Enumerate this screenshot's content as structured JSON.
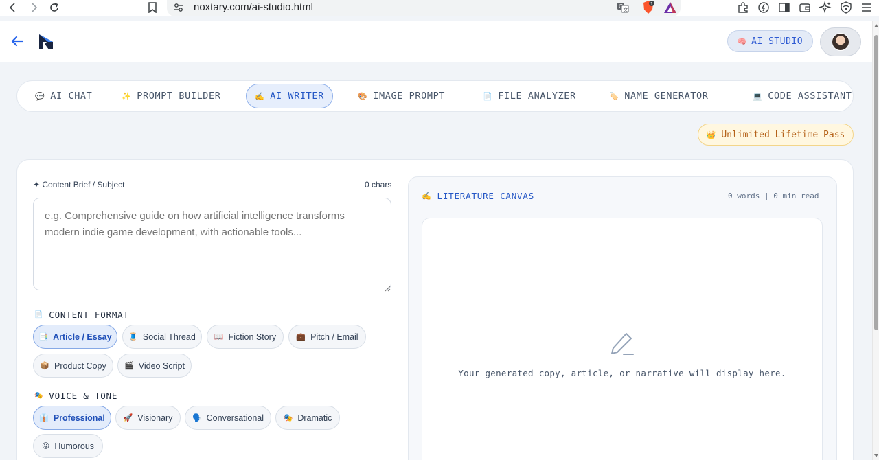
{
  "browser": {
    "url": "noxtary.com/ai-studio.html",
    "extension_badge": "1"
  },
  "header": {
    "studio_label": "AI STUDIO",
    "studio_icon": "🧠"
  },
  "tabs": [
    {
      "icon": "💬",
      "label": "AI CHAT"
    },
    {
      "icon": "✨",
      "label": "PROMPT BUILDER"
    },
    {
      "icon": "✍️",
      "label": "AI WRITER"
    },
    {
      "icon": "🎨",
      "label": "IMAGE PROMPT"
    },
    {
      "icon": "📄",
      "label": "FILE ANALYZER"
    },
    {
      "icon": "🏷️",
      "label": "NAME GENERATOR"
    },
    {
      "icon": "💻",
      "label": "CODE ASSISTANT"
    }
  ],
  "pass": {
    "icon": "👑",
    "label": "Unlimited Lifetime Pass"
  },
  "brief": {
    "label": "✦ Content Brief / Subject",
    "char_count": "0 chars",
    "placeholder": "e.g. Comprehensive guide on how artificial intelligence transforms modern indie game development, with actionable tools..."
  },
  "content_format": {
    "icon": "📄",
    "title": "CONTENT FORMAT",
    "options": [
      {
        "icon": "📑",
        "label": "Article / Essay"
      },
      {
        "icon": "🧵",
        "label": "Social Thread"
      },
      {
        "icon": "📖",
        "label": "Fiction Story"
      },
      {
        "icon": "💼",
        "label": "Pitch / Email"
      },
      {
        "icon": "📦",
        "label": "Product Copy"
      },
      {
        "icon": "🎬",
        "label": "Video Script"
      }
    ]
  },
  "voice_tone": {
    "icon": "🎭",
    "title": "VOICE & TONE",
    "options": [
      {
        "icon": "👔",
        "label": "Professional"
      },
      {
        "icon": "🚀",
        "label": "Visionary"
      },
      {
        "icon": "🗣️",
        "label": "Conversational"
      },
      {
        "icon": "🎭",
        "label": "Dramatic"
      },
      {
        "icon": "😜",
        "label": "Humorous"
      }
    ]
  },
  "canvas": {
    "icon": "✍️",
    "title": "LITERATURE CANVAS",
    "stats": "0 words | 0 min read",
    "placeholder": "Your generated copy, article, or narrative will display here."
  }
}
